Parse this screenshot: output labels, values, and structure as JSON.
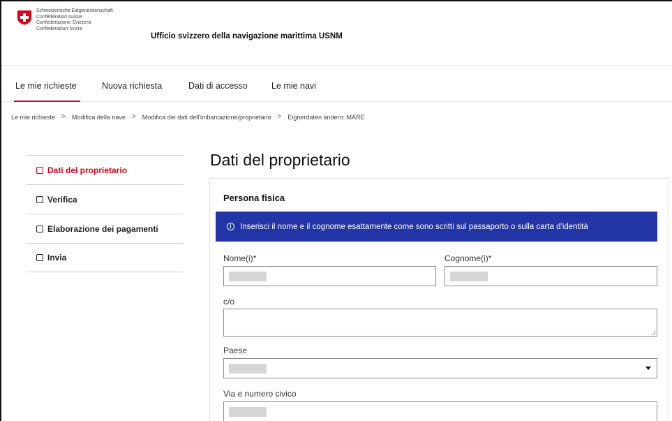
{
  "header": {
    "confederation_lines": [
      "Schweizerische Eidgenossenschaft",
      "Confédération suisse",
      "Confederazione Svizzera",
      "Confederaziun svizra"
    ],
    "office_title": "Ufficio svizzero della navigazione marittima USNM",
    "flag_color": "#dc0018"
  },
  "nav": {
    "tabs": [
      {
        "label": "Le mie richieste",
        "active": true
      },
      {
        "label": "Nuova richiesta",
        "active": false
      },
      {
        "label": "Dati di accesso",
        "active": false
      },
      {
        "label": "Le mie navi",
        "active": false
      }
    ]
  },
  "breadcrumb": {
    "items": [
      "Le mie richieste",
      "Modifica della nave",
      "Modifica dei dati dell'imbarcazione/proprietario",
      "Eignerdaten ändern: MARE"
    ],
    "separator": ">"
  },
  "sidebar": {
    "items": [
      {
        "label": "Dati del proprietario",
        "active": true
      },
      {
        "label": "Verifica",
        "active": false
      },
      {
        "label": "Elaborazione dei pagamenti",
        "active": false
      },
      {
        "label": "Invia",
        "active": false
      }
    ]
  },
  "main": {
    "title": "Dati del proprietario",
    "section_title": "Persona fisica",
    "info_banner": {
      "icon": "info-icon",
      "glyph": "i",
      "text": "Inserisci il nome e il cognome esattamente come sono scritti sul passaporto o sulla carta d'identità",
      "color": "#2335a6"
    },
    "fields": {
      "first_name_label": "Nome(i)*",
      "last_name_label": "Cognome(i)*",
      "care_of_label": "c/o",
      "country_label": "Paese",
      "street_label": "Via e numero civico"
    }
  },
  "colors": {
    "accent": "#dc0018",
    "banner": "#2335a6"
  }
}
